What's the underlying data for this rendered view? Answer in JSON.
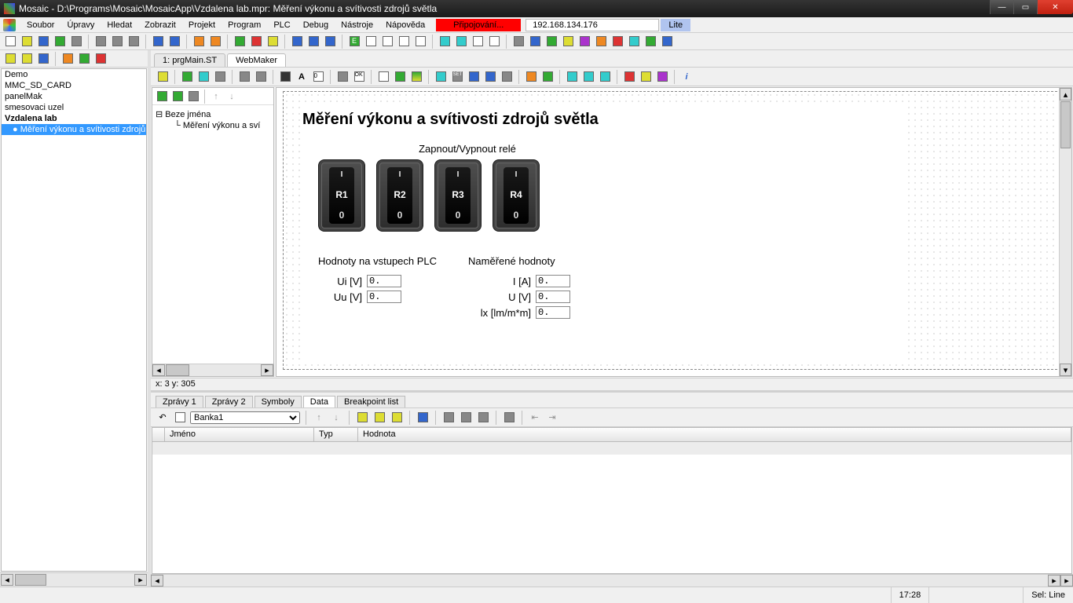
{
  "window": {
    "title": "Mosaic - D:\\Programs\\Mosaic\\MosaicApp\\Vzdalena lab.mpr: Měření výkonu a svítivosti zdrojů světla"
  },
  "menu": {
    "items": [
      "Soubor",
      "Úpravy",
      "Hledat",
      "Zobrazit",
      "Projekt",
      "Program",
      "PLC",
      "Debug",
      "Nástroje",
      "Nápověda"
    ],
    "status_connecting": "Připojování...",
    "status_ip": "192.168.134.176",
    "status_lite": "Lite"
  },
  "project_tree": {
    "items": [
      {
        "label": "Demo"
      },
      {
        "label": "MMC_SD_CARD"
      },
      {
        "label": "panelMak"
      },
      {
        "label": "smesovaci uzel"
      },
      {
        "label": "Vzdalena lab",
        "bold": true
      },
      {
        "label": "Měření výkonu a svítivosti zdrojů…",
        "selected": true,
        "indent": true
      }
    ]
  },
  "editor_tabs": {
    "tabs": [
      {
        "label": "1: prgMain.ST",
        "active": false
      },
      {
        "label": "WebMaker",
        "active": true
      }
    ]
  },
  "side_tree": {
    "root": "Beze jména",
    "child": "Měření výkonu a sví"
  },
  "page": {
    "heading": "Měření výkonu a svítivosti zdrojů světla",
    "relay_title": "Zapnout/Vypnout relé",
    "relays": [
      "R1",
      "R2",
      "R3",
      "R4"
    ],
    "relay_top": "I",
    "relay_bottom": "0",
    "inputs_heading": "Hodnoty na vstupech PLC",
    "measured_heading": "Naměřené hodnoty",
    "rows_left": [
      {
        "label": "Ui [V]",
        "value": "0."
      },
      {
        "label": "Uu [V]",
        "value": "0."
      }
    ],
    "rows_right": [
      {
        "label": "I [A]",
        "value": "0."
      },
      {
        "label": "U [V]",
        "value": "0."
      },
      {
        "label": "lx [lm/m*m]",
        "value": "0."
      }
    ]
  },
  "coord_bar": "x: 3 y: 305",
  "bottom": {
    "tabs": [
      "Zprávy 1",
      "Zprávy 2",
      "Symboly",
      "Data",
      "Breakpoint list"
    ],
    "active_tab": "Data",
    "bank_select": "Banka1",
    "columns": [
      "",
      "Jméno",
      "Typ",
      "Hodnota"
    ]
  },
  "statusbar": {
    "time": "17:28",
    "sel": "Sel: Line"
  }
}
